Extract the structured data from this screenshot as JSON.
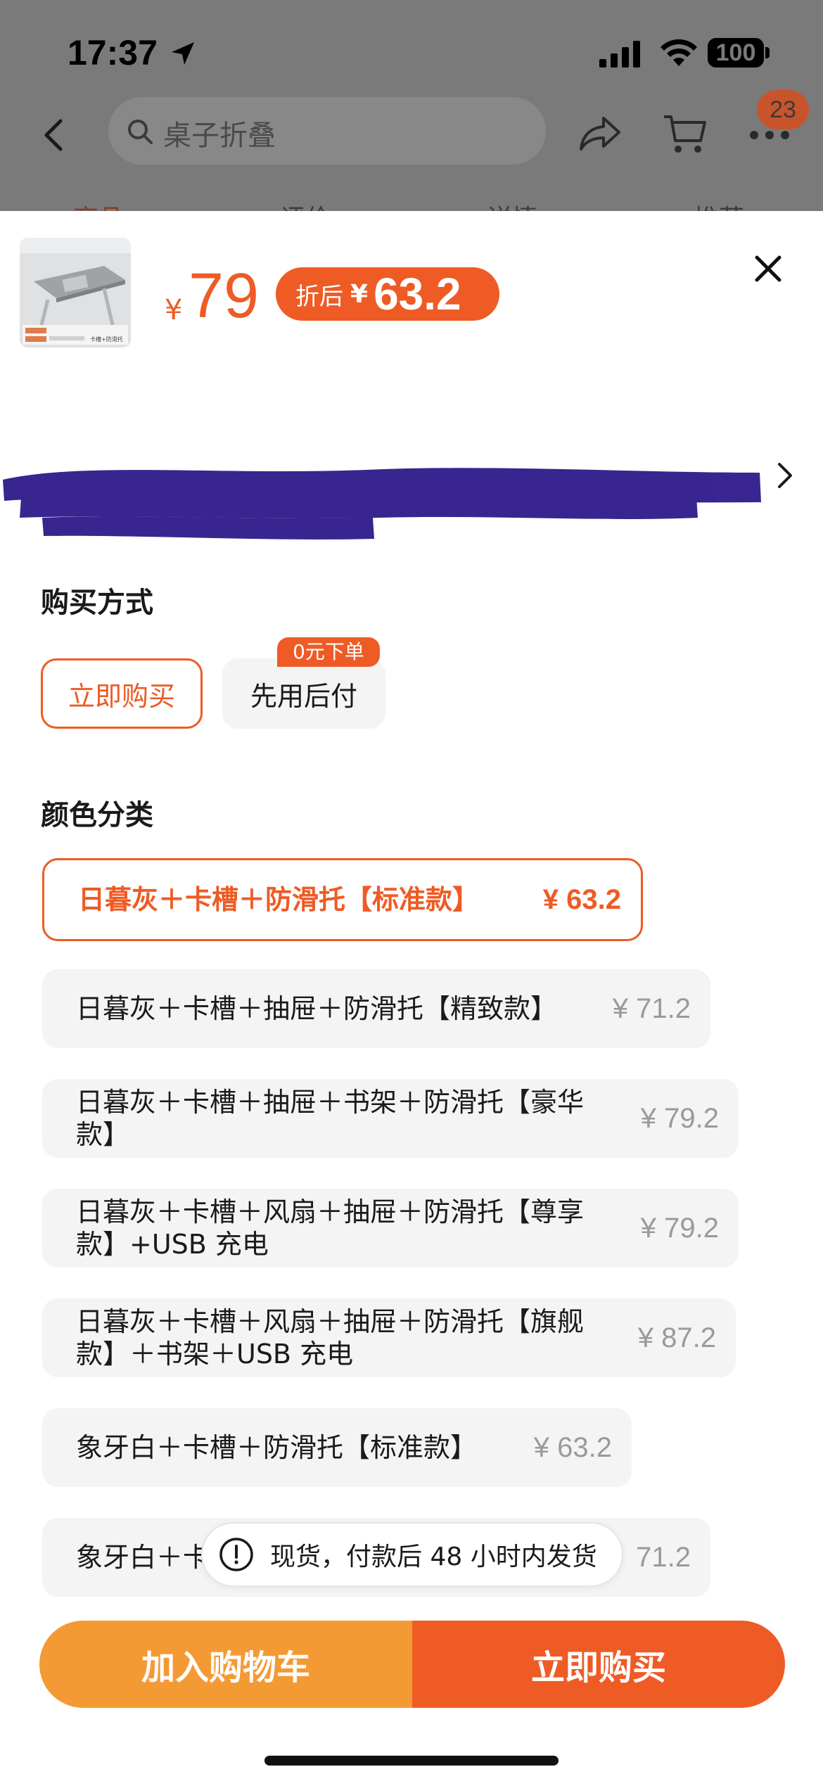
{
  "status_bar": {
    "time": "17:37",
    "battery": "100"
  },
  "header": {
    "search_placeholder": "桌子折叠",
    "message_badge": "23"
  },
  "background_tabs": [
    "商品",
    "评价",
    "详情",
    "推荐"
  ],
  "sheet": {
    "price_symbol": "¥",
    "price": "79",
    "discount_label": "折后",
    "discount_symbol": "¥",
    "discount_price": "63.2",
    "thumb_caption": "卡槽+防滑托"
  },
  "purchase_method": {
    "title": "购买方式",
    "options": [
      {
        "label": "立即购买",
        "selected": true
      },
      {
        "label": "先用后付",
        "selected": false,
        "badge": "0元下单"
      }
    ]
  },
  "color_category": {
    "title": "颜色分类",
    "variants": [
      {
        "line1": "日暮灰＋卡槽＋防滑托【标准款】",
        "line2": "",
        "price": "¥ 63.2",
        "selected": true
      },
      {
        "line1": "日暮灰＋卡槽＋抽屉＋防滑托【精致款】",
        "line2": "",
        "price": "¥ 71.2",
        "selected": false
      },
      {
        "line1": "日暮灰＋卡槽＋抽屉＋书架＋防滑托【豪华",
        "line2": "款】",
        "price": "¥ 79.2",
        "selected": false
      },
      {
        "line1": "日暮灰＋卡槽＋风扇＋抽屉＋防滑托【尊享",
        "line2": "款】+USB 充电",
        "price": "¥ 79.2",
        "selected": false
      },
      {
        "line1": "日暮灰＋卡槽＋风扇＋抽屉＋防滑托【旗舰",
        "line2": "款】＋书架＋USB 充电",
        "price": "¥ 87.2",
        "selected": false
      },
      {
        "line1": "象牙白＋卡槽＋防滑托【标准款】",
        "line2": "",
        "price": "¥ 63.2",
        "selected": false
      },
      {
        "line1": "象牙白＋卡",
        "line2": "",
        "price": "71.2",
        "selected": false
      }
    ]
  },
  "toast": {
    "text": "现货，付款后 48 小时内发货"
  },
  "bottom_actions": {
    "add_to_cart": "加入购物车",
    "buy_now": "立即购买"
  },
  "colors": {
    "accent": "#ee5b25",
    "cart_button": "#f49a35",
    "option_bg": "#f4f4f4"
  }
}
